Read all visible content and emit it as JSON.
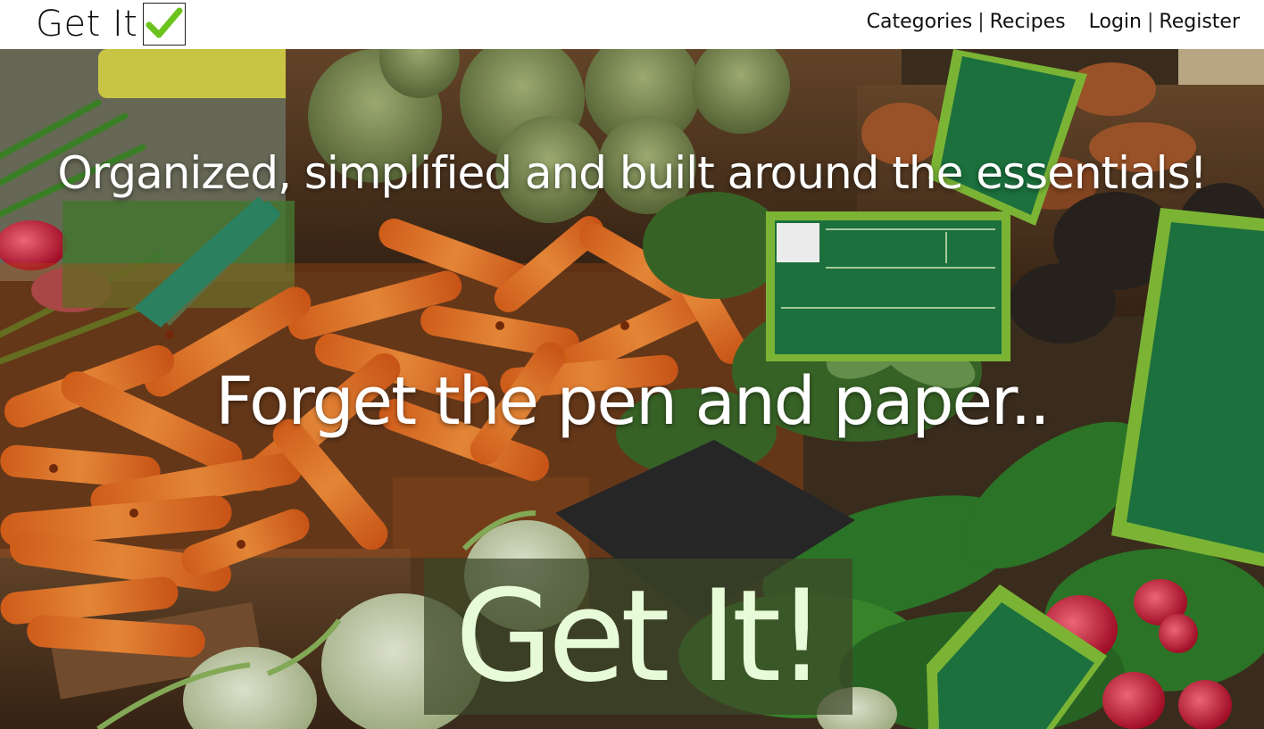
{
  "brand": {
    "text": "Get It",
    "icon": "check-icon"
  },
  "nav": {
    "categories": "Categories",
    "recipes": "Recipes",
    "login": "Login",
    "register": "Register",
    "separator": "|"
  },
  "hero": {
    "tagline": "Organized, simplified and built around the essentials!",
    "subtitle": "Forget the pen and paper..",
    "cta_label": "Get It!"
  },
  "colors": {
    "check_green": "#6cc31d",
    "cta_text": "#e8fbd8",
    "label_green": "#1f7a43"
  }
}
